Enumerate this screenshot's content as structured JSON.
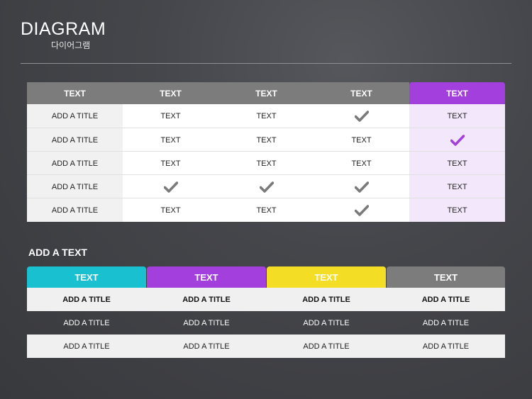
{
  "header": {
    "title": "DIAGRAM",
    "subtitle": "다이어그램"
  },
  "comparison_table": {
    "headers": [
      "TEXT",
      "TEXT",
      "TEXT",
      "TEXT",
      "TEXT"
    ],
    "highlight_color": "#a33fdc",
    "rows": [
      [
        "ADD A TITLE",
        "TEXT",
        "TEXT",
        "check",
        "TEXT"
      ],
      [
        "ADD A TITLE",
        "TEXT",
        "TEXT",
        "TEXT",
        "check"
      ],
      [
        "ADD A TITLE",
        "TEXT",
        "TEXT",
        "TEXT",
        "TEXT"
      ],
      [
        "ADD A TITLE",
        "check",
        "check",
        "check",
        "TEXT"
      ],
      [
        "ADD A TITLE",
        "TEXT",
        "TEXT",
        "check",
        "TEXT"
      ]
    ]
  },
  "section2": {
    "label": "ADD A TEXT",
    "tabs": [
      {
        "label": "TEXT",
        "color": "#18c0d0"
      },
      {
        "label": "TEXT",
        "color": "#a33fdc"
      },
      {
        "label": "TEXT",
        "color": "#f4de25"
      },
      {
        "label": "TEXT",
        "color": "#7c7c7c"
      }
    ],
    "rows": [
      [
        "ADD A TITLE",
        "ADD A TITLE",
        "ADD A TITLE",
        "ADD A TITLE"
      ],
      [
        "ADD A TITLE",
        "ADD A TITLE",
        "ADD A TITLE",
        "ADD A TITLE"
      ],
      [
        "ADD A TITLE",
        "ADD A TITLE",
        "ADD A TITLE",
        "ADD A TITLE"
      ]
    ]
  },
  "icons": {
    "check": "check-icon"
  }
}
